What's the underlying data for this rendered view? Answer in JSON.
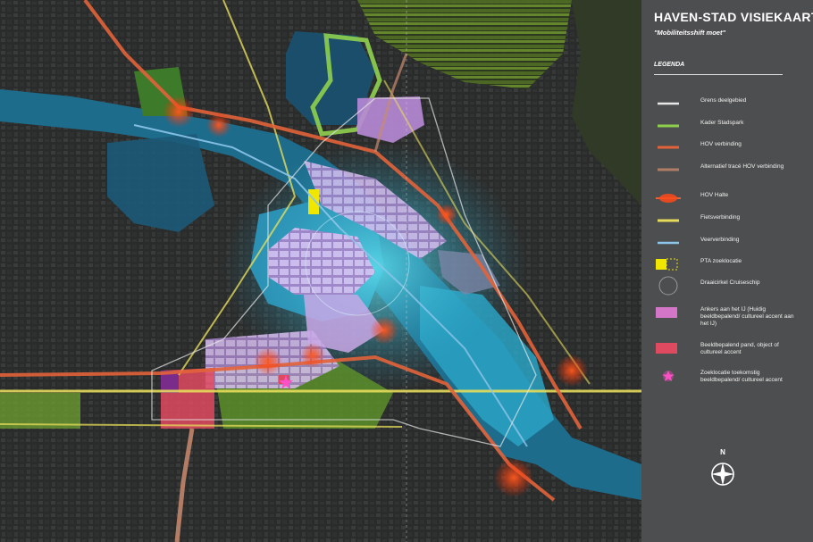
{
  "title": "HAVEN-STAD VISIEKAART",
  "subtitle": "\"Mobiliteitsshift moet\"",
  "legend": {
    "heading": "LEGENDA",
    "items": [
      {
        "label": "Grens deelgebied",
        "symbol": "white-line-icon",
        "color": "#e8e8e8"
      },
      {
        "label": "Kader Stadspark",
        "symbol": "green-line-icon",
        "color": "#8fd14f"
      },
      {
        "label": "HOV verbinding",
        "symbol": "orange-line-icon",
        "color": "#e2633a"
      },
      {
        "label": "Alternatief tracé HOV verbinding",
        "symbol": "faded-orange-line-icon",
        "color": "#c98a6e"
      },
      {
        "label": "HOV Halte",
        "symbol": "glow-stop-icon",
        "color": "#ff4a1a"
      },
      {
        "label": "Fietsverbinding",
        "symbol": "yellow-line-icon",
        "color": "#e6dc5a"
      },
      {
        "label": "Veerverbinding",
        "symbol": "blue-line-icon",
        "color": "#8cc6ea"
      },
      {
        "label": "PTA zoeklocatie",
        "symbol": "yellow-square-icon",
        "color": "#f1e600"
      },
      {
        "label": "Draaicirkel Cruiseschip",
        "symbol": "circle-outline-icon",
        "color": "#9a9a9a"
      },
      {
        "label": "Ankers aan het IJ (Huidig beeldbepalend/ cultureel accent aan het IJ)",
        "symbol": "pink-block-icon",
        "color": "#d476c8"
      },
      {
        "label": "Beeldbepalend pand, object of cultureel accent",
        "symbol": "red-block-icon",
        "color": "#e04a60"
      },
      {
        "label": "Zoeklocatie toekomstig beeldbepalend/ cultureel accent",
        "symbol": "pink-star-icon",
        "color": "#ff4fc7"
      }
    ]
  },
  "compass": {
    "label": "N",
    "icon": "compass-icon"
  },
  "colors": {
    "water": "#1f6f8f",
    "water_light": "#3fb6d6",
    "panel": "#4d4e4f",
    "purple": "#c9a8e6",
    "green": "#8fd14f",
    "red": "#e04a60",
    "orange": "#ff5a1f"
  }
}
